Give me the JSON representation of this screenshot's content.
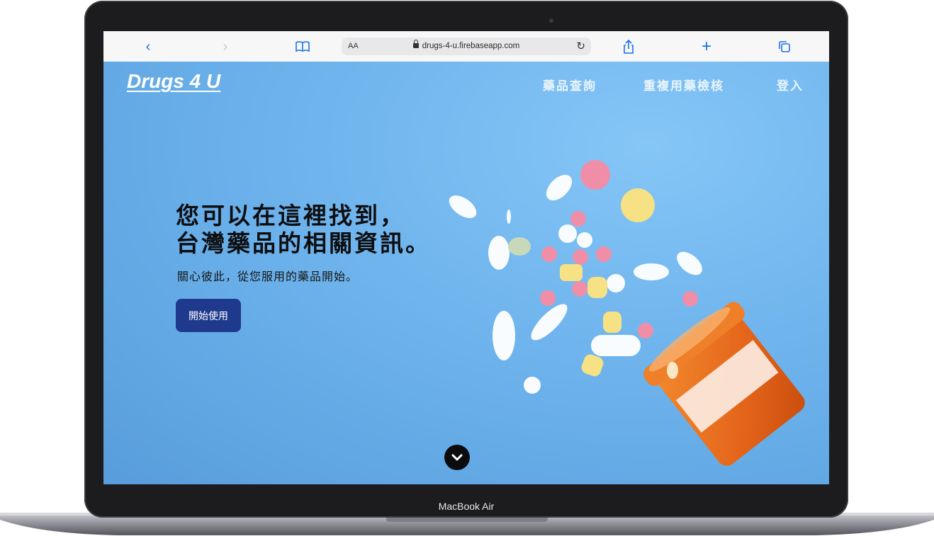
{
  "device": {
    "model_label": "MacBook Air"
  },
  "browser": {
    "reader_label": "AA",
    "url": "drugs-4-u.firebaseapp.com",
    "icons": [
      "back-icon",
      "forward-icon",
      "bookmarks-icon",
      "lock-icon",
      "reload-icon",
      "share-icon",
      "new-tab-icon",
      "tabs-icon"
    ]
  },
  "site": {
    "brand": "Drugs 4 U",
    "nav": {
      "drug_search": "藥品查詢",
      "duplicate_check": "重複用藥檢核",
      "login": "登入"
    },
    "hero": {
      "title_line1": "您可以在這裡找到，",
      "title_line2": "台灣藥品的相關資訊。",
      "subtitle": "關心彼此，從您服用的藥品開始。",
      "cta_label": "開始使用"
    },
    "icons": [
      "chevron-down-icon"
    ],
    "colors": {
      "background": "#6fb2ec",
      "cta": "#1f3a8d",
      "bottle": "#e86a1c"
    }
  }
}
